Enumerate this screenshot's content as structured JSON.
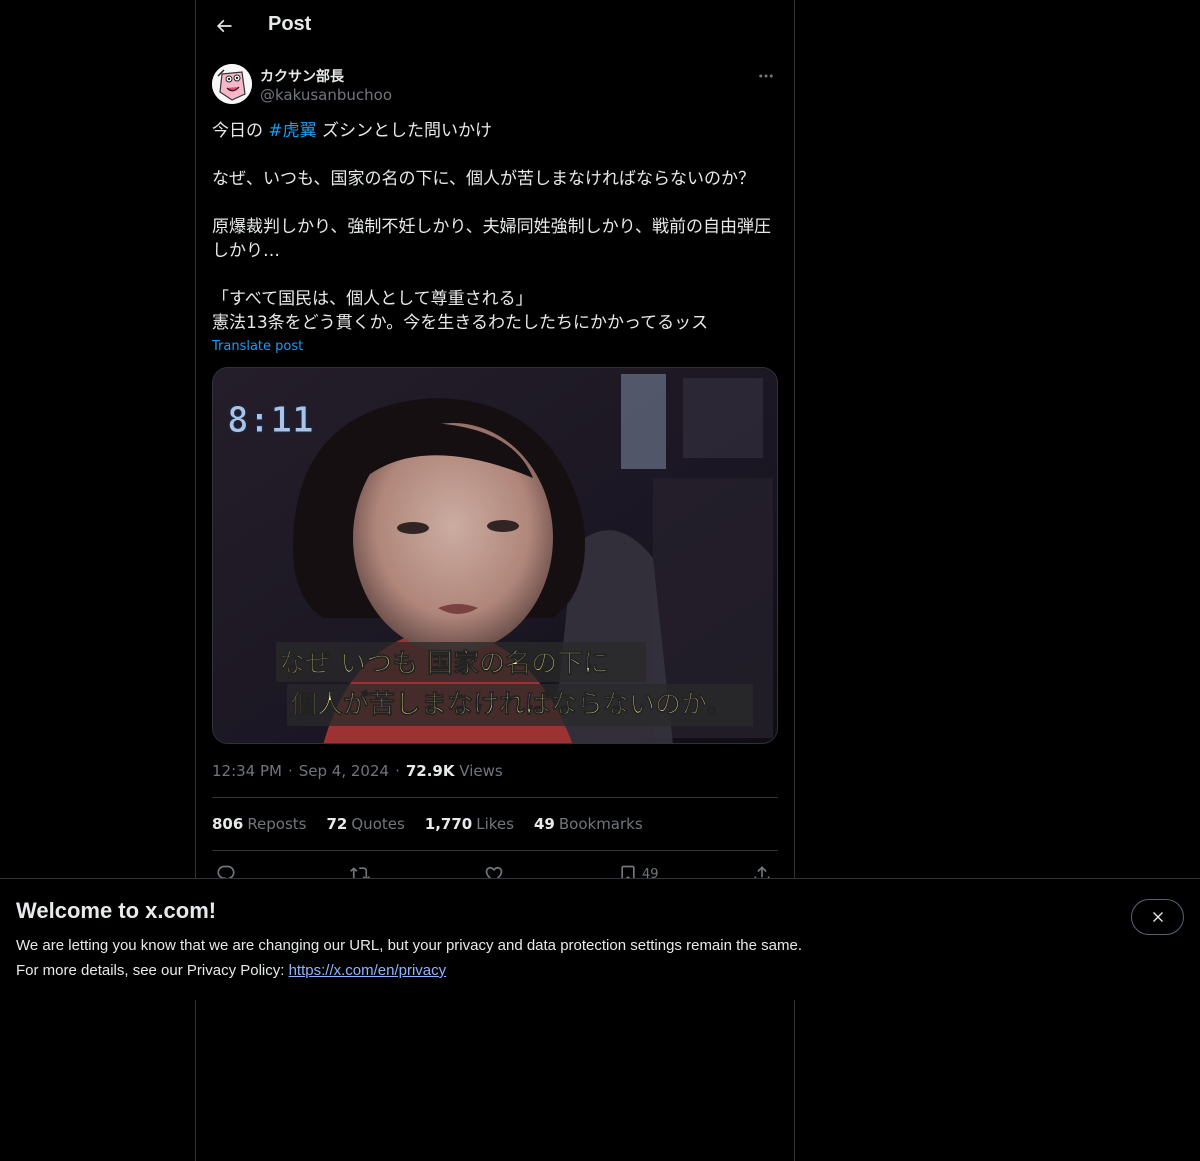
{
  "header": {
    "title": "Post"
  },
  "author": {
    "display_name": "カクサン部長",
    "handle": "@kakusanbuchoo"
  },
  "post": {
    "line1_prefix": "今日の ",
    "hashtag": "#虎翼",
    "line1_suffix": " ズシンとした問いかけ",
    "line2": "なぜ、いつも、国家の名の下に、個人が苦しまなければならないのか？",
    "line3": "原爆裁判しかり、強制不妊しかり、夫婦同姓強制しかり、戦前の自由弾圧",
    "line4": "しかり…",
    "line5": "「すべて国民は、個人として尊重される」",
    "line6": "憲法13条をどう貫くか。今を生きるわたしたちにかかってるッス",
    "translate": "Translate post"
  },
  "media": {
    "time_overlay": "8:11",
    "subtitle_line1": "なぜ いつも 国家の名の下に",
    "subtitle_line2": "個人が苦しまなければならないのか。"
  },
  "meta": {
    "time": "12:34 PM",
    "date": "Sep 4, 2024",
    "views_count": "72.9K",
    "views_label": "Views"
  },
  "stats": {
    "reposts_count": "806",
    "reposts_label": "Reposts",
    "quotes_count": "72",
    "quotes_label": "Quotes",
    "likes_count": "1,770",
    "likes_label": "Likes",
    "bookmarks_count": "49",
    "bookmarks_label": "Bookmarks"
  },
  "actions": {
    "bookmark_count": "49"
  },
  "banner": {
    "title": "Welcome to x.com!",
    "line1": "We are letting you know that we are changing our URL, but your privacy and data protection settings remain the same.",
    "line2_prefix": "For more details, see our Privacy Policy: ",
    "link": "https://x.com/en/privacy"
  },
  "colors": {
    "accent": "#1d9bf0",
    "background": "#000000",
    "border": "#2f3336",
    "muted": "#71767b",
    "subtitle_yellow": "#f5f08a"
  },
  "icons": [
    "back-arrow-icon",
    "more-icon",
    "reply-icon",
    "repost-icon",
    "like-icon",
    "bookmark-icon",
    "share-icon",
    "close-icon"
  ]
}
